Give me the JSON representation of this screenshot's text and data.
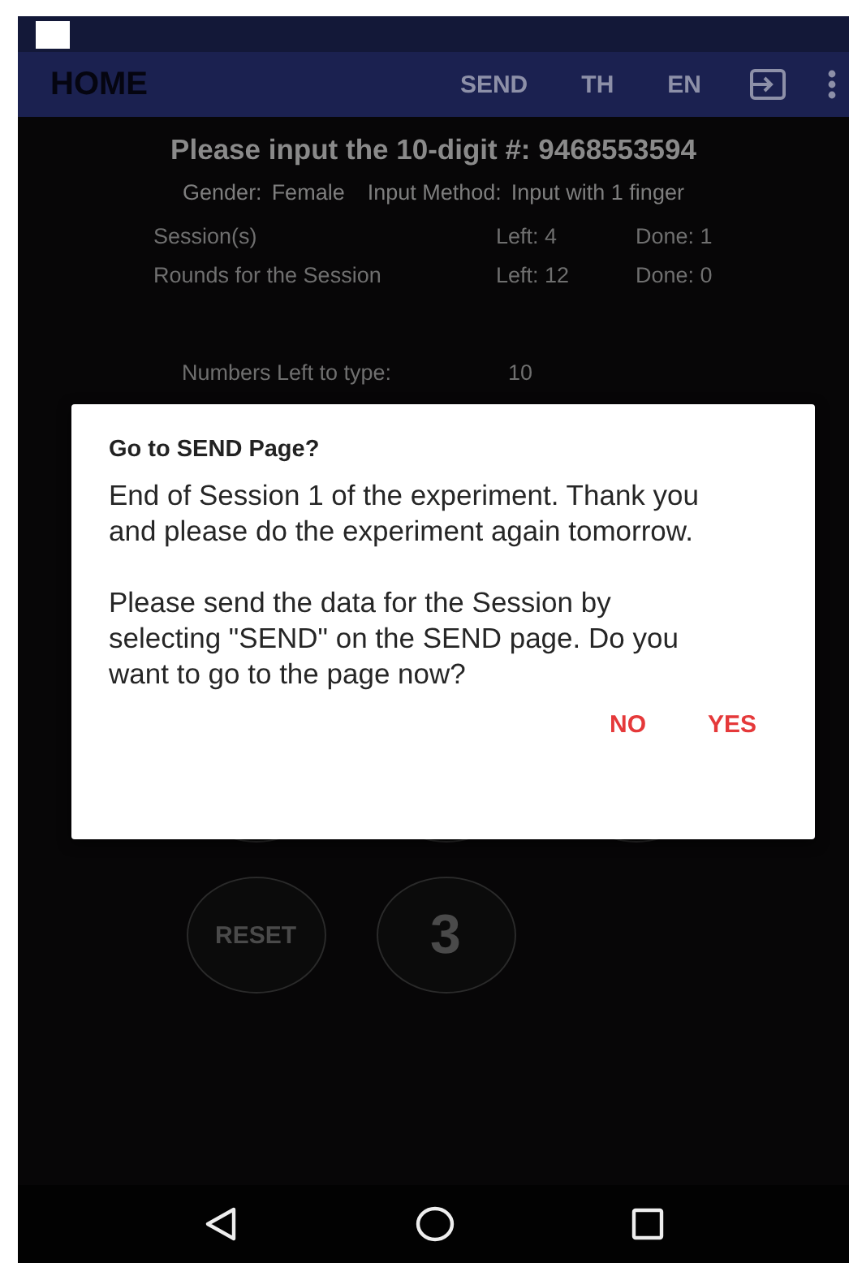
{
  "app_bar": {
    "title": "HOME",
    "actions": [
      {
        "kind": "text",
        "label": "SEND"
      },
      {
        "kind": "text",
        "label": "TH"
      },
      {
        "kind": "text",
        "label": "EN"
      },
      {
        "kind": "logout"
      },
      {
        "kind": "more"
      }
    ]
  },
  "prompt": "Please input the 10-digit #: 9468553594",
  "info": [
    {
      "label": "Gender:",
      "value": "Female"
    },
    {
      "label": "Input Method:",
      "value": "Input with 1 finger"
    }
  ],
  "counters": [
    {
      "name": "Session(s)",
      "left": "Left: 4",
      "done": "Done: 1"
    },
    {
      "name": "Rounds for the Session",
      "left": "Left: 12",
      "done": "Done: 0"
    }
  ],
  "numbers_left": {
    "label": "Numbers Left to type:",
    "value": "10"
  },
  "keypad": [
    [
      {
        "kind": "blank"
      },
      {
        "kind": "blank"
      },
      {
        "kind": "blank"
      }
    ],
    [
      {
        "kind": "word",
        "label": "RESET"
      },
      {
        "kind": "digit",
        "label": "3"
      }
    ]
  ],
  "dialog": {
    "title": "Go to SEND Page?",
    "paragraphs": [
      "End of Session 1 of the experiment. Thank you and please do the experiment again tomorrow.",
      "Please send the data for the Session by selecting \"SEND\" on the SEND page. Do you want to go to the page now?"
    ],
    "buttons": [
      "NO",
      "YES"
    ]
  },
  "nav_bar": [
    {
      "kind": "back"
    },
    {
      "kind": "home"
    },
    {
      "kind": "recents"
    }
  ]
}
